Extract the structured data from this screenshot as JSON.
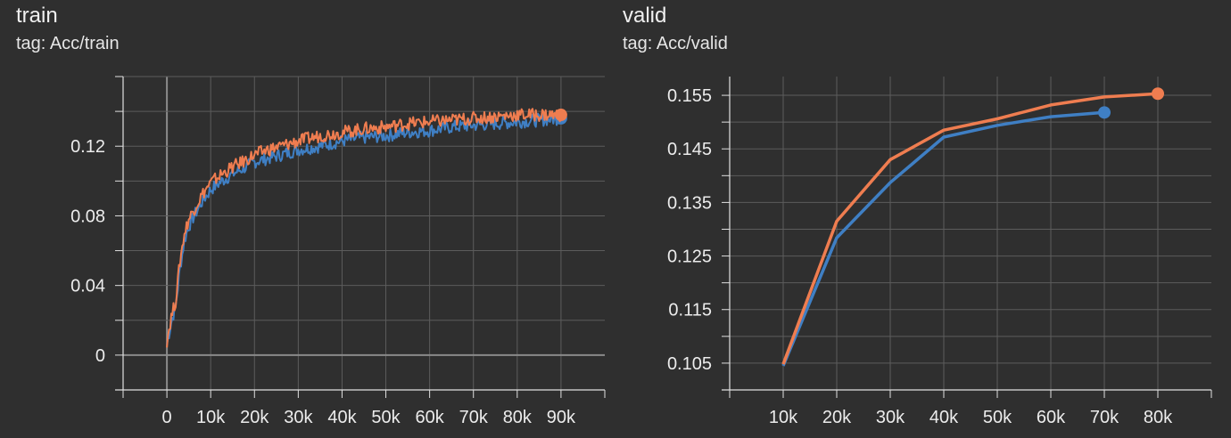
{
  "cards": {
    "train": {
      "title": "train",
      "tag": "tag: Acc/train"
    },
    "valid": {
      "title": "valid",
      "tag": "tag: Acc/valid"
    }
  },
  "colors": {
    "background": "#2f2f2f",
    "grid": "#5c5c5c",
    "axis": "#e0e0e0",
    "text": "#ececec",
    "series_orange": "#ef7d50",
    "series_blue": "#3f7fc4"
  },
  "chart_data": [
    {
      "id": "train",
      "type": "line",
      "title": "train",
      "subtitle": "tag: Acc/train",
      "xlabel": "",
      "ylabel": "",
      "xlim": [
        -10000,
        100000
      ],
      "ylim": [
        -0.02,
        0.16
      ],
      "xticks": [
        0,
        10000,
        20000,
        30000,
        40000,
        50000,
        60000,
        70000,
        80000,
        90000
      ],
      "xtick_labels": [
        "0",
        "10k",
        "20k",
        "30k",
        "40k",
        "50k",
        "60k",
        "70k",
        "80k",
        "90k"
      ],
      "yticks": [
        0,
        0.04,
        0.08,
        0.12
      ],
      "ytick_labels": [
        "0",
        "0.04",
        "0.08",
        "0.12"
      ],
      "grid": true,
      "series": [
        {
          "color": "#3f7fc4",
          "x": [
            0,
            1000,
            2000,
            3000,
            4000,
            5000,
            6000,
            8000,
            10000,
            12000,
            15000,
            18000,
            20000,
            23000,
            26000,
            30000,
            35000,
            40000,
            45000,
            50000,
            55000,
            60000,
            65000,
            70000,
            75000,
            80000,
            85000,
            90000
          ],
          "y": [
            0.006,
            0.019,
            0.028,
            0.05,
            0.066,
            0.074,
            0.079,
            0.088,
            0.095,
            0.099,
            0.104,
            0.108,
            0.111,
            0.113,
            0.115,
            0.118,
            0.12,
            0.123,
            0.125,
            0.126,
            0.128,
            0.129,
            0.131,
            0.132,
            0.133,
            0.134,
            0.135,
            0.136
          ]
        },
        {
          "color": "#ef7d50",
          "x": [
            0,
            1000,
            2000,
            3000,
            4000,
            5000,
            6000,
            8000,
            10000,
            12000,
            15000,
            18000,
            20000,
            23000,
            26000,
            30000,
            35000,
            40000,
            45000,
            50000,
            55000,
            60000,
            65000,
            70000,
            75000,
            80000,
            85000,
            90000
          ],
          "y": [
            0.008,
            0.022,
            0.031,
            0.054,
            0.07,
            0.078,
            0.083,
            0.092,
            0.099,
            0.103,
            0.108,
            0.112,
            0.115,
            0.118,
            0.12,
            0.123,
            0.126,
            0.128,
            0.13,
            0.131,
            0.133,
            0.134,
            0.135,
            0.136,
            0.137,
            0.138,
            0.138,
            0.138
          ]
        }
      ]
    },
    {
      "id": "valid",
      "type": "line",
      "title": "valid",
      "subtitle": "tag: Acc/valid",
      "xlabel": "",
      "ylabel": "",
      "xlim": [
        0,
        90000
      ],
      "ylim": [
        0.1,
        0.1585
      ],
      "xticks": [
        10000,
        20000,
        30000,
        40000,
        50000,
        60000,
        70000,
        80000
      ],
      "xtick_labels": [
        "10k",
        "20k",
        "30k",
        "40k",
        "50k",
        "60k",
        "70k",
        "80k"
      ],
      "yticks": [
        0.105,
        0.115,
        0.125,
        0.135,
        0.145,
        0.155
      ],
      "ytick_labels": [
        "0.105",
        "0.115",
        "0.125",
        "0.135",
        "0.145",
        "0.155"
      ],
      "grid": true,
      "series": [
        {
          "color": "#3f7fc4",
          "x": [
            10000,
            20000,
            30000,
            40000,
            50000,
            60000,
            70000
          ],
          "y": [
            0.1045,
            0.1284,
            0.1387,
            0.1472,
            0.1494,
            0.151,
            0.1518
          ]
        },
        {
          "color": "#ef7d50",
          "x": [
            10000,
            20000,
            30000,
            40000,
            50000,
            60000,
            70000,
            80000
          ],
          "y": [
            0.1048,
            0.1315,
            0.143,
            0.1485,
            0.1506,
            0.1532,
            0.1547,
            0.1553
          ]
        }
      ]
    }
  ]
}
